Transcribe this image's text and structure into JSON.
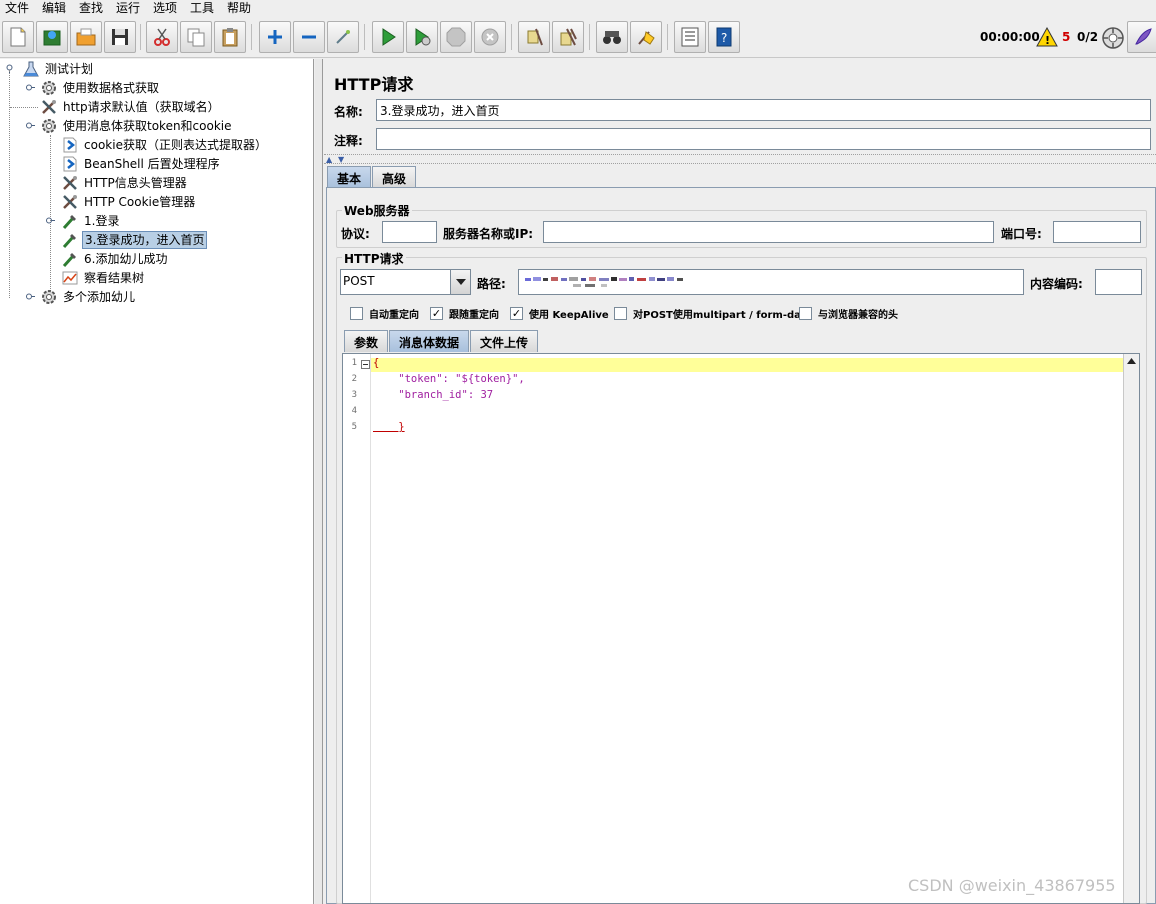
{
  "menu": [
    "文件",
    "编辑",
    "查找",
    "运行",
    "选项",
    "工具",
    "帮助"
  ],
  "status": {
    "timer": "00:00:00",
    "warnings": "5",
    "threads": "0/2"
  },
  "tree": {
    "items": [
      {
        "label": "测试计划",
        "icon": "test-plan-icon"
      },
      {
        "label": "使用数据格式获取",
        "icon": "thread-group-gear-icon"
      },
      {
        "label": "http请求默认值（获取域名）",
        "icon": "config-tool-icon"
      },
      {
        "label": "使用消息体获取token和cookie",
        "icon": "thread-group-gear-icon"
      },
      {
        "label": "cookie获取（正则表达式提取器）",
        "icon": "post-processor-icon"
      },
      {
        "label": "BeanShell 后置处理程序",
        "icon": "post-processor-icon"
      },
      {
        "label": "HTTP信息头管理器",
        "icon": "config-tool-icon"
      },
      {
        "label": "HTTP Cookie管理器",
        "icon": "config-tool-icon"
      },
      {
        "label": "1.登录",
        "icon": "sampler-pipette-icon"
      },
      {
        "label": "3.登录成功，进入首页",
        "icon": "sampler-pipette-icon"
      },
      {
        "label": "6.添加幼儿成功",
        "icon": "sampler-pipette-icon"
      },
      {
        "label": "察看结果树",
        "icon": "listener-chart-icon"
      },
      {
        "label": "多个添加幼儿",
        "icon": "thread-group-gear-icon"
      }
    ]
  },
  "panel": {
    "title": "HTTP请求",
    "name_label": "名称:",
    "name_value": "3.登录成功，进入首页",
    "comment_label": "注释:",
    "comment_value": ""
  },
  "tabs": {
    "outer": [
      "基本",
      "高级"
    ],
    "inner": [
      "参数",
      "消息体数据",
      "文件上传"
    ]
  },
  "web_server": {
    "title": "Web服务器",
    "protocol_label": "协议:",
    "server_label": "服务器名称或IP:",
    "port_label": "端口号:"
  },
  "http_request": {
    "title": "HTTP请求",
    "method": "POST",
    "path_label": "路径:",
    "encoding_label": "内容编码:"
  },
  "checkboxes": [
    {
      "label": "自动重定向",
      "checked": false
    },
    {
      "label": "跟随重定向",
      "checked": true
    },
    {
      "label": "使用 KeepAlive",
      "checked": true
    },
    {
      "label": "对POST使用multipart / form-data",
      "checked": false
    },
    {
      "label": "与浏览器兼容的头",
      "checked": false
    }
  ],
  "body": {
    "line_numbers": [
      "1",
      "2",
      "3",
      "4",
      "5"
    ],
    "lines": [
      "{",
      "    \"token\": \"${token}\",",
      "    \"branch_id\": 37",
      "",
      "    }"
    ]
  },
  "watermark": "CSDN @weixin_43867955"
}
